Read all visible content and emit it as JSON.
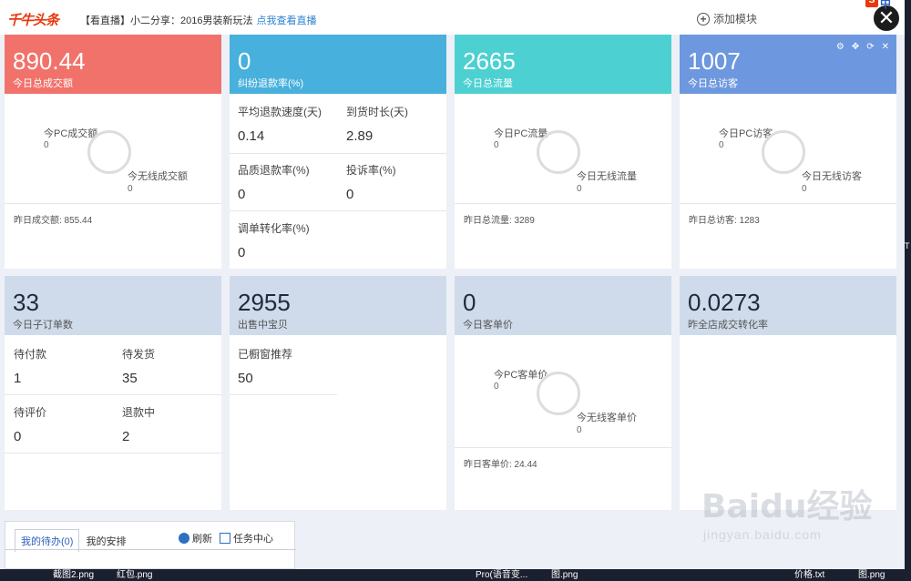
{
  "topbar": {
    "logo": "千牛头条",
    "headline_prefix": "【看直播】小二分享：2016男装新玩法",
    "headline_link": "点我查看直播",
    "add_module": "添加模块",
    "close": "✕",
    "ime_s": "S",
    "ime_z": "中"
  },
  "cards": {
    "sales": {
      "value": "890.44",
      "label": "今日总成交额",
      "color": "#f1726b",
      "pc_label": "今PC成交额",
      "pc_value": "0",
      "mobile_label": "今无线成交额",
      "mobile_value": "0",
      "footer": "昨日成交额: 855.44"
    },
    "refund": {
      "value": "0",
      "label": "纠纷退款率(%)",
      "color": "#48b0dc",
      "items": [
        {
          "k": "平均退款速度(天)",
          "v": "0.14"
        },
        {
          "k": "到货时长(天)",
          "v": "2.89"
        },
        {
          "k": "品质退款率(%)",
          "v": "0"
        },
        {
          "k": "投诉率(%)",
          "v": "0"
        },
        {
          "k": "调单转化率(%)",
          "v": "0"
        }
      ]
    },
    "traffic": {
      "value": "2665",
      "label": "今日总流量",
      "color": "#4dd0d2",
      "pc_label": "今日PC流量",
      "pc_value": "0",
      "mobile_label": "今日无线流量",
      "mobile_value": "0",
      "footer": "昨日总流量: 3289"
    },
    "visitors": {
      "value": "1007",
      "label": "今日总访客",
      "color": "#6d97de",
      "icons": [
        "⚙",
        "✥",
        "⟳",
        "✕"
      ],
      "pc_label": "今日PC访客",
      "pc_value": "0",
      "mobile_label": "今日无线访客",
      "mobile_value": "0",
      "footer": "昨日总访客: 1283"
    },
    "orders": {
      "value": "33",
      "label": "今日子订单数",
      "items": [
        {
          "k": "待付款",
          "v": "1"
        },
        {
          "k": "待发货",
          "v": "35"
        },
        {
          "k": "待评价",
          "v": "0"
        },
        {
          "k": "退款中",
          "v": "2"
        }
      ]
    },
    "items_sale": {
      "value": "2955",
      "label": "出售中宝贝",
      "items": [
        {
          "k": "已橱窗推荐",
          "v": "50"
        }
      ]
    },
    "avg_price": {
      "value": "0",
      "label": "今日客单价",
      "pc_label": "今PC客单价",
      "pc_value": "0",
      "mobile_label": "今无线客单价",
      "mobile_value": "0",
      "footer": "昨日客单价: 24.44"
    },
    "conversion": {
      "value": "0.0273",
      "label": "昨全店成交转化率"
    }
  },
  "todo": {
    "tabs": [
      "我的待办(0)",
      "我的安排"
    ],
    "refresh": "刷新",
    "task_center": "任务中心"
  },
  "taskbar": {
    "items": [
      "截图2.png",
      "红包.png",
      "Pro(语音变...",
      "图.png",
      "价格.txt",
      "图.png"
    ]
  },
  "watermark": {
    "main": "Baidu经验",
    "sub": "jingyan.baidu.com"
  },
  "side_t": "T"
}
